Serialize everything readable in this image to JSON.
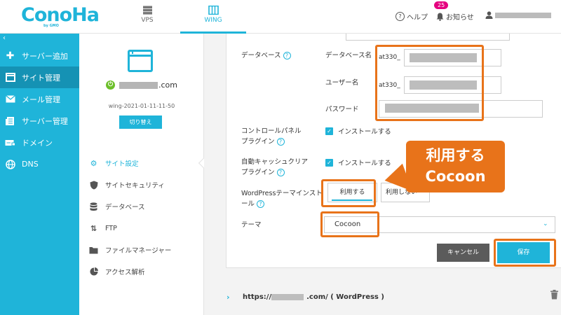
{
  "header": {
    "logo": "ConoHa",
    "logo_sub": "by GMO",
    "tabs": [
      {
        "label": "VPS",
        "icon": "server-icon"
      },
      {
        "label": "WING",
        "icon": "wing-server-icon"
      }
    ],
    "help": "ヘルプ",
    "notifications_label": "お知らせ",
    "notifications_count": "25"
  },
  "sidebar": {
    "collapse": "‹",
    "items": [
      {
        "label": "サーバー追加",
        "icon": "plus-icon"
      },
      {
        "label": "サイト管理",
        "icon": "site-icon"
      },
      {
        "label": "メール管理",
        "icon": "mail-icon"
      },
      {
        "label": "サーバー管理",
        "icon": "server-manage-icon"
      },
      {
        "label": "ドメイン",
        "icon": "domain-icon"
      },
      {
        "label": "DNS",
        "icon": "globe-icon"
      }
    ]
  },
  "site_panel": {
    "domain_suffix": ".com",
    "site_id": "wing-2021-01-11-11-50",
    "switch_label": "切り替え",
    "menu": [
      {
        "label": "サイト設定",
        "icon": "gear-icon"
      },
      {
        "label": "サイトセキュリティ",
        "icon": "shield-icon"
      },
      {
        "label": "データベース",
        "icon": "database-icon"
      },
      {
        "label": "FTP",
        "icon": "ftp-icon"
      },
      {
        "label": "ファイルマネージャー",
        "icon": "folder-icon"
      },
      {
        "label": "アクセス解析",
        "icon": "pie-chart-icon"
      }
    ]
  },
  "form": {
    "database_label": "データベース",
    "db_name_label": "データベース名",
    "db_name_prefix": "at330_",
    "user_name_label": "ユーザー名",
    "user_name_prefix": "at330_",
    "password_label": "パスワード",
    "control_panel_label": "コントロールパネルプラグイン",
    "control_panel_line1": "コントロールパネル",
    "control_panel_line2": "プラグイン",
    "control_panel_check": "インストールする",
    "cache_line1": "自動キャッシュクリア",
    "cache_line2": "プラグイン",
    "cache_check": "インストールする",
    "wp_theme_line1": "WordPressテーマインスト",
    "wp_theme_line2": "ール",
    "use_label": "利用する",
    "no_use_label": "利用しない",
    "theme_label": "テーマ",
    "theme_value": "Cocoon",
    "cancel_label": "キャンセル",
    "save_label": "保存"
  },
  "callout": {
    "line1": "利用する",
    "line2": "Cocoon"
  },
  "bottom": {
    "url_prefix": "https://",
    "url_suffix": ".com/ ( WordPress )"
  },
  "colors": {
    "accent": "#1fb4d9",
    "highlight": "#e8731a",
    "sidebar_active": "#1592b4"
  }
}
